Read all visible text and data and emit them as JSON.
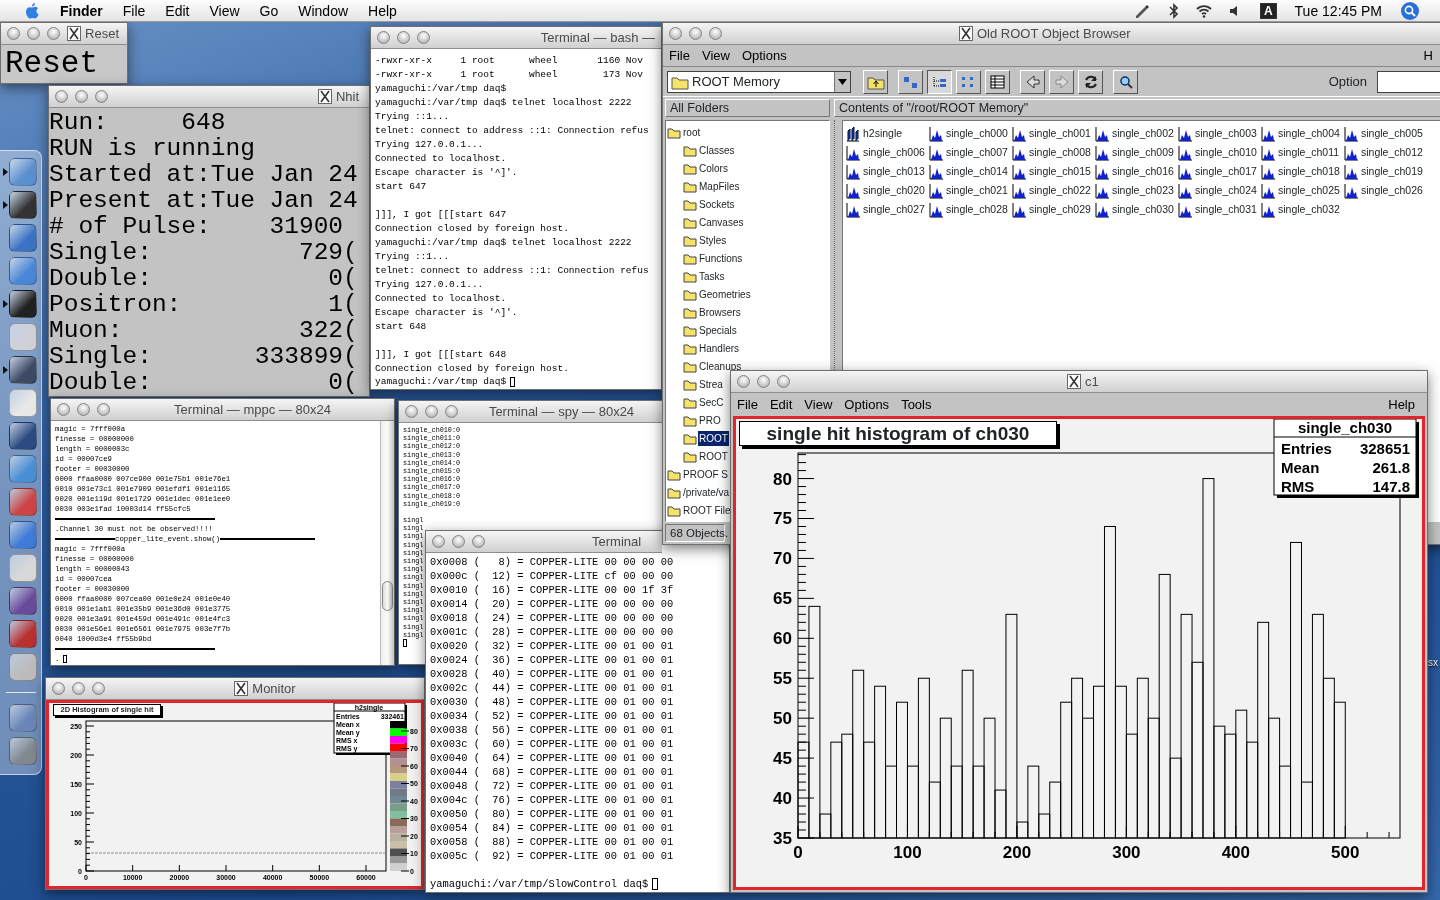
{
  "menubar": {
    "menus": [
      {
        "label": "Finder",
        "bold": true
      },
      {
        "label": "File",
        "bold": false
      },
      {
        "label": "Edit",
        "bold": false
      },
      {
        "label": "View",
        "bold": false
      },
      {
        "label": "Go",
        "bold": false
      },
      {
        "label": "Window",
        "bold": false
      },
      {
        "label": "Help",
        "bold": false
      }
    ],
    "input_menu": "A",
    "clock": "Tue 12:45 PM"
  },
  "dock": {
    "apps": [
      {
        "running": true
      },
      {
        "running": true
      },
      {
        "running": false
      },
      {
        "running": false
      },
      {
        "running": true
      },
      {
        "running": false
      },
      {
        "running": true
      },
      {
        "running": false
      },
      {
        "running": false
      },
      {
        "running": false
      },
      {
        "running": false
      },
      {
        "running": false
      },
      {
        "running": false
      },
      {
        "running": false
      },
      {
        "running": false
      },
      {
        "running": false
      },
      {
        "running": false
      },
      {
        "running": false
      }
    ]
  },
  "desktop_label": "sx",
  "reset_window": {
    "title": "Reset",
    "button": "Reset"
  },
  "nhit_window": {
    "title": "Nhit",
    "lines": [
      "Run:     648",
      "RUN is running",
      "Started at:Tue Jan 24",
      "Present at:Tue Jan 24",
      "# of Pulse:    31900",
      "Single:          729(",
      "Double:            0(",
      "Positron:          1(",
      "Muon:            322(",
      "Single:       333899(",
      "Double:            0("
    ]
  },
  "bash_terminal": {
    "title": "Terminal — bash —",
    "lines": [
      {
        "kind": "text",
        "text": "-rwxr-xr-x     1 root      wheel       1160 Nov"
      },
      {
        "kind": "text",
        "text": "-rwxr-xr-x     1 root      wheel        173 Nov"
      },
      {
        "kind": "text",
        "text": "yamaguchi:/var/tmp daq$"
      },
      {
        "kind": "text",
        "text": "yamaguchi:/var/tmp daq$ telnet localhost 2222"
      },
      {
        "kind": "text",
        "text": "Trying ::1..."
      },
      {
        "kind": "text",
        "text": "telnet: connect to address ::1: Connection refus"
      },
      {
        "kind": "text",
        "text": "Trying 127.0.0.1..."
      },
      {
        "kind": "text",
        "text": "Connected to localhost."
      },
      {
        "kind": "text",
        "text": "Escape character is '^]'."
      },
      {
        "kind": "text",
        "text": "start 647"
      },
      {
        "kind": "blank"
      },
      {
        "kind": "text",
        "text": "]]], I got [[[start 647"
      },
      {
        "kind": "text",
        "text": "Connection closed by foreign host."
      },
      {
        "kind": "text",
        "text": "yamaguchi:/var/tmp daq$ telnet localhost 2222"
      },
      {
        "kind": "text",
        "text": "Trying ::1..."
      },
      {
        "kind": "text",
        "text": "telnet: connect to address ::1: Connection refus"
      },
      {
        "kind": "text",
        "text": "Trying 127.0.0.1..."
      },
      {
        "kind": "text",
        "text": "Connected to localhost."
      },
      {
        "kind": "text",
        "text": "Escape character is '^]'."
      },
      {
        "kind": "text",
        "text": "start 648"
      },
      {
        "kind": "blank"
      },
      {
        "kind": "text",
        "text": "]]], I got [[[start 648"
      },
      {
        "kind": "text",
        "text": "Connection closed by foreign host."
      },
      {
        "kind": "prompt",
        "text": "yamaguchi:/var/tmp daq$"
      }
    ]
  },
  "browser": {
    "title": "Old ROOT Object Browser",
    "menus": [
      "File",
      "View",
      "Options"
    ],
    "help_menu": "H",
    "location": "ROOT Memory",
    "view_modes": [
      {
        "selected": false
      },
      {
        "selected": true
      },
      {
        "selected": false
      },
      {
        "selected": false
      }
    ],
    "option_label": "Option",
    "folders_header": "All Folders",
    "contents_header": "Contents of \"/root/ROOT Memory\"",
    "tree": [
      {
        "label": "root",
        "selected": false,
        "children": [
          {
            "label": "Classes",
            "selected": false
          },
          {
            "label": "Colors",
            "selected": false
          },
          {
            "label": "MapFiles",
            "selected": false
          },
          {
            "label": "Sockets",
            "selected": false
          },
          {
            "label": "Canvases",
            "selected": false
          },
          {
            "label": "Styles",
            "selected": false
          },
          {
            "label": "Functions",
            "selected": false
          },
          {
            "label": "Tasks",
            "selected": false
          },
          {
            "label": "Geometries",
            "selected": false
          },
          {
            "label": "Browsers",
            "selected": false
          },
          {
            "label": "Specials",
            "selected": false
          },
          {
            "label": "Handlers",
            "selected": false
          },
          {
            "label": "Cleanups",
            "selected": false
          },
          {
            "label": "Strea",
            "selected": false
          },
          {
            "label": "SecC",
            "selected": false
          },
          {
            "label": "PRO",
            "selected": false
          },
          {
            "label": "ROOT",
            "selected": true
          },
          {
            "label": "ROOT",
            "selected": false
          }
        ]
      },
      {
        "label": "PROOF S",
        "selected": false
      },
      {
        "label": "/private/va",
        "selected": false
      },
      {
        "label": "ROOT File",
        "selected": false
      }
    ],
    "items": [
      {
        "kind": "h2",
        "label": "h2single"
      },
      {
        "kind": "h1",
        "label": "single_ch000"
      },
      {
        "kind": "h1",
        "label": "single_ch001"
      },
      {
        "kind": "h1",
        "label": "single_ch002"
      },
      {
        "kind": "h1",
        "label": "single_ch003"
      },
      {
        "kind": "h1",
        "label": "single_ch004"
      },
      {
        "kind": "h1",
        "label": "single_ch005"
      },
      {
        "kind": "h1",
        "label": "single_ch006"
      },
      {
        "kind": "h1",
        "label": "single_ch007"
      },
      {
        "kind": "h1",
        "label": "single_ch008"
      },
      {
        "kind": "h1",
        "label": "single_ch009"
      },
      {
        "kind": "h1",
        "label": "single_ch010"
      },
      {
        "kind": "h1",
        "label": "single_ch011"
      },
      {
        "kind": "h1",
        "label": "single_ch012"
      },
      {
        "kind": "h1",
        "label": "single_ch013"
      },
      {
        "kind": "h1",
        "label": "single_ch014"
      },
      {
        "kind": "h1",
        "label": "single_ch015"
      },
      {
        "kind": "h1",
        "label": "single_ch016"
      },
      {
        "kind": "h1",
        "label": "single_ch017"
      },
      {
        "kind": "h1",
        "label": "single_ch018"
      },
      {
        "kind": "h1",
        "label": "single_ch019"
      },
      {
        "kind": "h1",
        "label": "single_ch020"
      },
      {
        "kind": "h1",
        "label": "single_ch021"
      },
      {
        "kind": "h1",
        "label": "single_ch022"
      },
      {
        "kind": "h1",
        "label": "single_ch023"
      },
      {
        "kind": "h1",
        "label": "single_ch024"
      },
      {
        "kind": "h1",
        "label": "single_ch025"
      },
      {
        "kind": "h1",
        "label": "single_ch026"
      },
      {
        "kind": "h1",
        "label": "single_ch027"
      },
      {
        "kind": "h1",
        "label": "single_ch028"
      },
      {
        "kind": "h1",
        "label": "single_ch029"
      },
      {
        "kind": "h1",
        "label": "single_ch030"
      },
      {
        "kind": "h1",
        "label": "single_ch031"
      },
      {
        "kind": "h1",
        "label": "single_ch032"
      }
    ],
    "status": "68 Objects."
  },
  "mppc_terminal": {
    "title": "Terminal — mppc — 80x24",
    "lines": [
      {
        "kind": "text",
        "text": "magic = 7fff000a"
      },
      {
        "kind": "text",
        "text": "finesse = 00000000"
      },
      {
        "kind": "text",
        "text": "length = 0000003c"
      },
      {
        "kind": "text",
        "text": "id = 00007ce9"
      },
      {
        "kind": "text",
        "text": "footer = 00030000"
      },
      {
        "kind": "text",
        "text": "0000 ffaa0000 007ce900 001e75b1 001e76e1"
      },
      {
        "kind": "text",
        "text": "0010 001e73c1 001e7909 001efdf1 001e1165"
      },
      {
        "kind": "text",
        "text": "0020 001e119d 001e1729 001e1dec 001e1ee0"
      },
      {
        "kind": "text",
        "text": "0030 003e1fad 10003d14 ff55cfc5"
      },
      {
        "kind": "rule"
      },
      {
        "kind": "text",
        "text": ".Channel 30 must not be observed!!!!"
      },
      {
        "kind": "banner",
        "text": "copper_lite_event.show()"
      },
      {
        "kind": "text",
        "text": "magic = 7fff000a"
      },
      {
        "kind": "text",
        "text": "finesse = 00000000"
      },
      {
        "kind": "text",
        "text": "length = 00000043"
      },
      {
        "kind": "text",
        "text": "id = 00007cea"
      },
      {
        "kind": "text",
        "text": "footer = 00030000"
      },
      {
        "kind": "text",
        "text": "0000 ffaa0000 007cea00 001e0e24 001e0e40"
      },
      {
        "kind": "text",
        "text": "0010 001e1ab1 001e35b9 001e36d0 001e3775"
      },
      {
        "kind": "text",
        "text": "0020 001e3a91 001e459d 001e491c 001e4fc3"
      },
      {
        "kind": "text",
        "text": "0030 001e56e1 001e6561 001e7975 003e7f7b"
      },
      {
        "kind": "text",
        "text": "0040 1000d3e4 ff55b9bd"
      },
      {
        "kind": "rule"
      },
      {
        "kind": "prompt",
        "text": "."
      }
    ]
  },
  "spy_terminal": {
    "title": "Terminal — spy — 80x24",
    "lines": [
      {
        "kind": "text",
        "text": "single_ch010:0"
      },
      {
        "kind": "text",
        "text": "single_ch011:0"
      },
      {
        "kind": "text",
        "text": "single_ch012:0"
      },
      {
        "kind": "text",
        "text": "single_ch013:0"
      },
      {
        "kind": "text",
        "text": "single_ch014:0"
      },
      {
        "kind": "text",
        "text": "single_ch015:0"
      },
      {
        "kind": "text",
        "text": "single_ch016:0"
      },
      {
        "kind": "text",
        "text": "single_ch017:0"
      },
      {
        "kind": "text",
        "text": "single_ch018:0"
      },
      {
        "kind": "text",
        "text": "single_ch019:0"
      },
      {
        "kind": "blank"
      },
      {
        "kind": "text",
        "text": "singl"
      },
      {
        "kind": "text",
        "text": "singl"
      },
      {
        "kind": "text",
        "text": "singl"
      },
      {
        "kind": "text",
        "text": "singl"
      },
      {
        "kind": "text",
        "text": "singl"
      },
      {
        "kind": "text",
        "text": "singl"
      },
      {
        "kind": "text",
        "text": "singl"
      },
      {
        "kind": "text",
        "text": "singl"
      },
      {
        "kind": "text",
        "text": "singl"
      },
      {
        "kind": "text",
        "text": "singl"
      },
      {
        "kind": "text",
        "text": "singl"
      },
      {
        "kind": "text",
        "text": "singl"
      },
      {
        "kind": "text",
        "text": "singl"
      },
      {
        "kind": "text",
        "text": "singl"
      },
      {
        "kind": "text",
        "text": "singl"
      },
      {
        "kind": "cursor"
      }
    ]
  },
  "monitor_window": {
    "title": "Monitor",
    "plot_title": "2D Histogram of single hit",
    "stats_title": "h2single",
    "stats": [
      {
        "label": "Entries",
        "value": "332461"
      },
      {
        "label": "Mean x"
      },
      {
        "label": "Mean y"
      },
      {
        "label": "RMS x"
      },
      {
        "label": "RMS y"
      }
    ],
    "y_ticks": [
      "250",
      "200",
      "150",
      "100",
      "50",
      "0"
    ],
    "x_ticks": [
      "0",
      "10000",
      "20000",
      "30000",
      "40000",
      "50000",
      "60000"
    ],
    "palette_ticks": [
      "80",
      "70",
      "60",
      "50",
      "40",
      "30",
      "20",
      "10",
      "0"
    ]
  },
  "copper_terminal": {
    "title": "Terminal",
    "lines": [
      {
        "kind": "text",
        "text": "0x0008 (   8) = COPPER-LITE 00 00 00 00"
      },
      {
        "kind": "text",
        "text": "0x000c (  12) = COPPER-LITE cf 00 00 00"
      },
      {
        "kind": "text",
        "text": "0x0010 (  16) = COPPER-LITE 00 00 1f 3f"
      },
      {
        "kind": "text",
        "text": "0x0014 (  20) = COPPER-LITE 00 00 00 00"
      },
      {
        "kind": "text",
        "text": "0x0018 (  24) = COPPER-LITE 00 00 00 00"
      },
      {
        "kind": "text",
        "text": "0x001c (  28) = COPPER-LITE 00 00 00 00"
      },
      {
        "kind": "text",
        "text": "0x0020 (  32) = COPPER-LITE 00 01 00 01"
      },
      {
        "kind": "text",
        "text": "0x0024 (  36) = COPPER-LITE 00 01 00 01"
      },
      {
        "kind": "text",
        "text": "0x0028 (  40) = COPPER-LITE 00 01 00 01"
      },
      {
        "kind": "text",
        "text": "0x002c (  44) = COPPER-LITE 00 01 00 01"
      },
      {
        "kind": "text",
        "text": "0x0030 (  48) = COPPER-LITE 00 01 00 01"
      },
      {
        "kind": "text",
        "text": "0x0034 (  52) = COPPER-LITE 00 01 00 01"
      },
      {
        "kind": "text",
        "text": "0x0038 (  56) = COPPER-LITE 00 01 00 01"
      },
      {
        "kind": "text",
        "text": "0x003c (  60) = COPPER-LITE 00 01 00 01"
      },
      {
        "kind": "text",
        "text": "0x0040 (  64) = COPPER-LITE 00 01 00 01"
      },
      {
        "kind": "text",
        "text": "0x0044 (  68) = COPPER-LITE 00 01 00 01"
      },
      {
        "kind": "text",
        "text": "0x0048 (  72) = COPPER-LITE 00 01 00 01"
      },
      {
        "kind": "text",
        "text": "0x004c (  76) = COPPER-LITE 00 01 00 01"
      },
      {
        "kind": "text",
        "text": "0x0050 (  80) = COPPER-LITE 00 01 00 01"
      },
      {
        "kind": "text",
        "text": "0x0054 (  84) = COPPER-LITE 00 01 00 01"
      },
      {
        "kind": "text",
        "text": "0x0058 (  88) = COPPER-LITE 00 01 00 01"
      },
      {
        "kind": "text",
        "text": "0x005c (  92) = COPPER-LITE 00 01 00 01"
      },
      {
        "kind": "blank"
      },
      {
        "kind": "prompt",
        "text": "yamaguchi:/var/tmp/SlowControl daq$"
      }
    ]
  },
  "canvas_window": {
    "title": "c1",
    "menus": [
      "File",
      "Edit",
      "View",
      "Options",
      "Tools"
    ],
    "help_menu": "Help",
    "stats_title": "single_ch030",
    "stats": [
      {
        "label": "Entries",
        "value": "328651"
      },
      {
        "label": "Mean",
        "value": "261.8"
      },
      {
        "label": "RMS",
        "value": "147.8"
      }
    ],
    "chart_data": {
      "type": "bar",
      "title": "single hit histogram of ch030",
      "x": [
        5,
        15,
        25,
        35,
        45,
        55,
        65,
        75,
        85,
        95,
        105,
        115,
        125,
        135,
        145,
        155,
        165,
        175,
        185,
        195,
        205,
        215,
        225,
        235,
        245,
        255,
        265,
        275,
        285,
        295,
        305,
        315,
        325,
        335,
        345,
        355,
        365,
        375,
        385,
        395,
        405,
        415,
        425,
        435,
        445,
        455,
        465,
        475,
        485,
        495
      ],
      "values": [
        47,
        64,
        38,
        47,
        48,
        56,
        47,
        54,
        44,
        52,
        44,
        55,
        42,
        50,
        44,
        56,
        44,
        50,
        41,
        63,
        37,
        44,
        38,
        42,
        52,
        55,
        50,
        54,
        74,
        54,
        48,
        55,
        50,
        68,
        45,
        63,
        57,
        80,
        49,
        48,
        51,
        47,
        62,
        50,
        44,
        72,
        42,
        63,
        55,
        52
      ],
      "xlim": [
        0,
        550
      ],
      "ylim": [
        35,
        83.2
      ],
      "xticks": [
        0,
        100,
        200,
        300,
        400,
        500
      ],
      "yticks": [
        35,
        40,
        45,
        50,
        55,
        60,
        65,
        70,
        75,
        80
      ]
    }
  }
}
